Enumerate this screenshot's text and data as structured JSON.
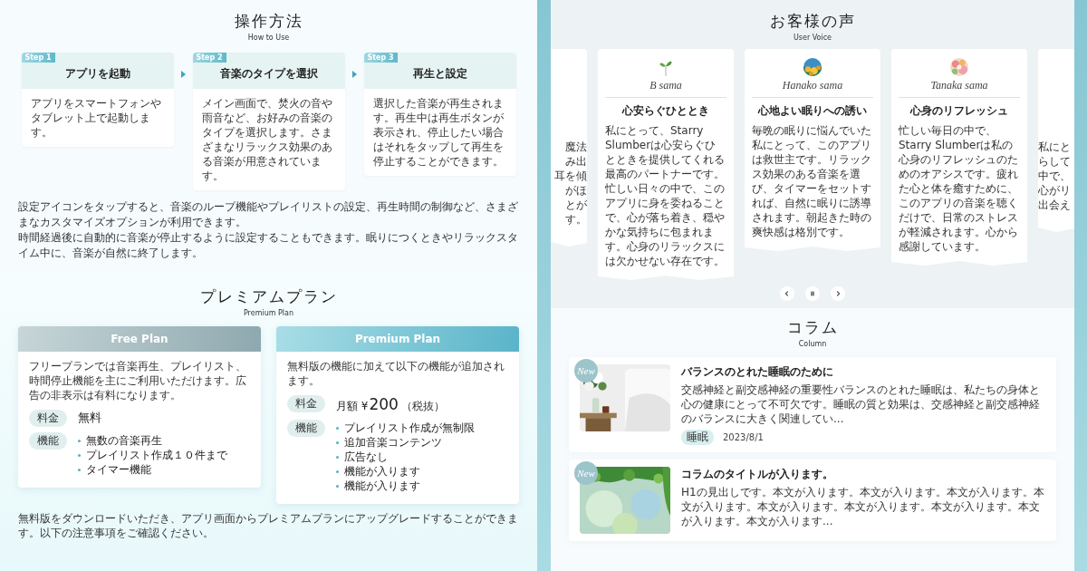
{
  "how_to_use": {
    "title": "操作方法",
    "subtitle": "How to Use",
    "steps": [
      {
        "badge": "Step 1",
        "title": "アプリを起動",
        "text": "アプリをスマートフォンやタブレット上で起動します。"
      },
      {
        "badge": "Step 2",
        "title": "音楽のタイプを選択",
        "text": "メイン画面で、焚火の音や雨音など、お好みの音楽のタイプを選択します。さまざまなリラックス効果のある音楽が用意されています。"
      },
      {
        "badge": "Step 3",
        "title": "再生と設定",
        "text": "選択した音楽が再生されます。再生中は再生ボタンが表示され、停止したい場合はそれをタップして再生を停止することができます。"
      }
    ],
    "paragraphs": [
      "設定アイコンをタップすると、音楽のループ機能やプレイリストの設定、再生時間の制御など、さまざまなカスタマイズオプションが利用できます。",
      "時間経過後に自動的に音楽が停止するように設定することもできます。眠りにつくときやリラックスタイム中に、音楽が自然に終了します。"
    ]
  },
  "premium": {
    "title": "プレミアムプラン",
    "subtitle": "Premium Plan",
    "plans": [
      {
        "kind": "free",
        "name": "Free Plan",
        "description": "フリープランでは音楽再生、プレイリスト、時間停止機能を主にご利用いただけます。広告の非表示は有料になります。",
        "price_label": "料金",
        "price": [
          {
            "kind": "main",
            "text": "無料"
          }
        ],
        "features_label": "機能",
        "features": [
          "無数の音楽再生",
          "プレイリスト作成１０件まで",
          "タイマー機能"
        ]
      },
      {
        "kind": "premium",
        "name": "Premium Plan",
        "description": "無料版の機能に加えて以下の機能が追加されます。",
        "price_label": "料金",
        "price": [
          {
            "kind": "prefix",
            "text": "月額 ¥"
          },
          {
            "kind": "amount",
            "text": "200"
          },
          {
            "kind": "note",
            "text": "（税抜）"
          }
        ],
        "features_label": "機能",
        "features": [
          "プレイリスト作成が無制限",
          "追加音楽コンテンツ",
          "広告なし",
          "機能が入ります",
          "機能が入ります"
        ]
      }
    ],
    "footnote": "無料版をダウンロードいただき、アプリ画面からプレミアムプランにアップグレードすることができます。以下の注意事項をご確認ください。"
  },
  "voice": {
    "title": "お客様の声",
    "subtitle": "User Voice",
    "edge_left": [
      "魔法",
      "み出",
      "耳を傾",
      "がほ",
      "とが",
      "す。"
    ],
    "cards": [
      {
        "kind": "sprout",
        "name": "B sama",
        "title": "心安らぐひととき",
        "text": "私にとって、Starry Slumberは心安らぐひとときを提供してくれる最高のパートナーです。忙しい日々の中で、このアプリに身を委ねることで、心が落ち着き、穏やかな気持ちに包まれます。心身のリラックスには欠かせない存在です。"
      },
      {
        "kind": "picture",
        "name": "Hanako sama",
        "title": "心地よい眠りへの誘い",
        "text": "毎晩の眠りに悩んでいた私にとって、このアプリは救世主です。リラックス効果のある音楽を選び、タイマーをセットすれば、自然に眠りに誘導されます。朝起きた時の爽快感は格別です。"
      },
      {
        "kind": "picture",
        "name": "Tanaka sama",
        "title": "心身のリフレッシュ",
        "text": "忙しい毎日の中で、Starry Slumberは私の心身のリフレッシュのためのオアシスです。疲れた心と体を癒すために、このアプリの音楽を聴くだけで、日常のストレスが軽減されます。心から感謝しています。"
      }
    ],
    "edge_right": [
      "私にと",
      "らして",
      "中で、",
      "心がリ",
      "出会え"
    ],
    "controls": [
      {
        "kind": "prev"
      },
      {
        "kind": "pause"
      },
      {
        "kind": "next"
      }
    ]
  },
  "column": {
    "title": "コラム",
    "subtitle": "Column",
    "articles": [
      {
        "badge": "New",
        "title": "バランスのとれた睡眠のために",
        "excerpt": "交感神経と副交感神経の重要性バランスのとれた睡眠は、私たちの身体と心の健康にとって不可欠です。睡眠の質と効果は、交感神経と副交感神経のバランスに大きく関連してい...",
        "tag": "睡眠",
        "date": "2023/8/1"
      },
      {
        "badge": "New",
        "title": "コラムのタイトルが入ります。",
        "excerpt": "H1の見出しです。本文が入ります。本文が入ります。本文が入ります。本文が入ります。本文が入ります。本文が入ります。本文が入ります。本文が入ります。本文が入ります..."
      }
    ]
  }
}
